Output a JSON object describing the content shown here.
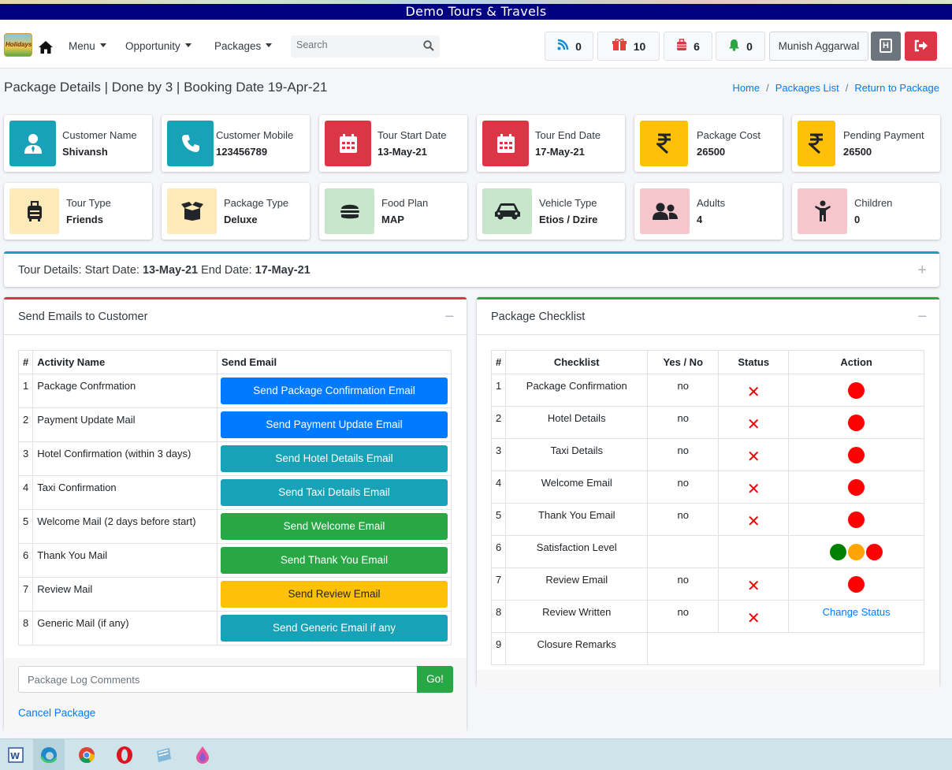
{
  "app": {
    "title": "Demo Tours & Travels",
    "logo_text": "Holidays"
  },
  "nav": {
    "menu": "Menu",
    "opportunity": "Opportunity",
    "packages": "Packages",
    "search_placeholder": "Search"
  },
  "counters": [
    {
      "icon": "rss-icon",
      "value": "0",
      "color": "#0d8fd1"
    },
    {
      "icon": "gift-box-icon",
      "value": "10",
      "color": "#e0443a"
    },
    {
      "icon": "suitcase-icon",
      "value": "6",
      "color": "#dc3545"
    },
    {
      "icon": "bell-icon",
      "value": "0",
      "color": "#28a745"
    }
  ],
  "user": {
    "name": "Munish Aggarwal",
    "hotel_icon": "H"
  },
  "page": {
    "heading": "Package Details | Done by 3 | Booking Date 19-Apr-21"
  },
  "breadcrumb": {
    "home": "Home",
    "list": "Packages List",
    "back": "Return to Package",
    "separator": "/"
  },
  "info": [
    {
      "label": "Customer Name",
      "value": "Shivansh",
      "icon": "user-icon",
      "bg": "#17a2b8"
    },
    {
      "label": "Customer Mobile",
      "value": "123456789",
      "icon": "phone-icon",
      "bg": "#17a2b8"
    },
    {
      "label": "Tour Start Date",
      "value": "13-May-21",
      "icon": "calendar-icon",
      "bg": "#dc3545"
    },
    {
      "label": "Tour End Date",
      "value": "17-May-21",
      "icon": "calendar-icon",
      "bg": "#dc3545"
    },
    {
      "label": "Package Cost",
      "value": "26500",
      "icon": "rupee-icon",
      "bg": "#ffc107"
    },
    {
      "label": "Pending Payment",
      "value": "26500",
      "icon": "rupee-icon",
      "bg": "#ffc107"
    },
    {
      "label": "Tour Type",
      "value": "Friends",
      "icon": "suitcase-icon",
      "bg": "#fdeab8"
    },
    {
      "label": "Package Type",
      "value": "Deluxe",
      "icon": "open-box-icon",
      "bg": "#fdeab8"
    },
    {
      "label": "Food Plan",
      "value": "MAP",
      "icon": "burger-icon",
      "bg": "#c8e6cb"
    },
    {
      "label": "Vehicle Type",
      "value": "Etios / Dzire",
      "icon": "car-icon",
      "bg": "#c8e6cb"
    },
    {
      "label": "Adults",
      "value": "4",
      "icon": "users-icon",
      "bg": "#f5c6cb"
    },
    {
      "label": "Children",
      "value": "0",
      "icon": "child-icon",
      "bg": "#f5c6cb"
    }
  ],
  "tour": {
    "prefix": "Tour Details: Start Date: ",
    "start": "13-May-21",
    "mid": " End Date: ",
    "end": "17-May-21",
    "toggle": "+"
  },
  "emails": {
    "title": "Send Emails to Customer",
    "toggle": "−",
    "headers": [
      "#",
      "Activity Name",
      "Send Email"
    ],
    "rows": [
      {
        "n": "1",
        "activity": "Package Confrmation",
        "button": "Send Package Confirmation Email",
        "color": "#007bff",
        "text_color": "#fff"
      },
      {
        "n": "2",
        "activity": "Payment Update Mail",
        "button": "Send Payment Update Email",
        "color": "#007bff",
        "text_color": "#fff"
      },
      {
        "n": "3",
        "activity": "Hotel Confirmation (within 3 days)",
        "button": "Send Hotel Details Email",
        "color": "#17a2b8",
        "text_color": "#fff"
      },
      {
        "n": "4",
        "activity": "Taxi Confirmation",
        "button": "Send Taxi Details Email",
        "color": "#17a2b8",
        "text_color": "#fff"
      },
      {
        "n": "5",
        "activity": "Welcome Mail (2 days before start)",
        "button": "Send Welcome Email",
        "color": "#28a745",
        "text_color": "#fff"
      },
      {
        "n": "6",
        "activity": "Thank You Mail",
        "button": "Send Thank You Email",
        "color": "#28a745",
        "text_color": "#fff"
      },
      {
        "n": "7",
        "activity": "Review Mail",
        "button": "Send Review Email",
        "color": "#ffc107",
        "text_color": "#212529"
      },
      {
        "n": "8",
        "activity": "Generic Mail (if any)",
        "button": "Send Generic Email if any",
        "color": "#17a2b8",
        "text_color": "#fff"
      }
    ],
    "comment_placeholder": "Package Log Comments",
    "go": "Go!",
    "cancel": "Cancel Package"
  },
  "checklist": {
    "title": "Package Checklist",
    "toggle": "−",
    "headers": [
      "#",
      "Checklist",
      "Yes / No",
      "Status",
      "Action"
    ],
    "rows": [
      {
        "n": "1",
        "item": "Package Confirmation",
        "yn": "no",
        "status": "x",
        "action": "red-dot"
      },
      {
        "n": "2",
        "item": "Hotel Details",
        "yn": "no",
        "status": "x",
        "action": "red-dot"
      },
      {
        "n": "3",
        "item": "Taxi Details",
        "yn": "no",
        "status": "x",
        "action": "red-dot"
      },
      {
        "n": "4",
        "item": "Welcome Email",
        "yn": "no",
        "status": "x",
        "action": "red-dot"
      },
      {
        "n": "5",
        "item": "Thank You Email",
        "yn": "no",
        "status": "x",
        "action": "red-dot"
      },
      {
        "n": "6",
        "item": "Satisfaction Level",
        "yn": "",
        "status": "",
        "action": "three-dots"
      },
      {
        "n": "7",
        "item": "Review Email",
        "yn": "no",
        "status": "x",
        "action": "red-dot"
      },
      {
        "n": "8",
        "item": "Review Written",
        "yn": "no",
        "status": "x",
        "action": "link",
        "link": "Change Status"
      },
      {
        "n": "9",
        "item": "Closure Remarks",
        "yn": "",
        "status": "",
        "action": "closure"
      }
    ],
    "status_symbol": "✕",
    "dot_colors": {
      "red": "#ff0000",
      "green": "#008000",
      "orange": "#ffa500"
    }
  },
  "taskbar": [
    "word-icon",
    "edge-icon",
    "chrome-icon",
    "opera-icon",
    "notepad-icon",
    "paint-drop-icon"
  ]
}
